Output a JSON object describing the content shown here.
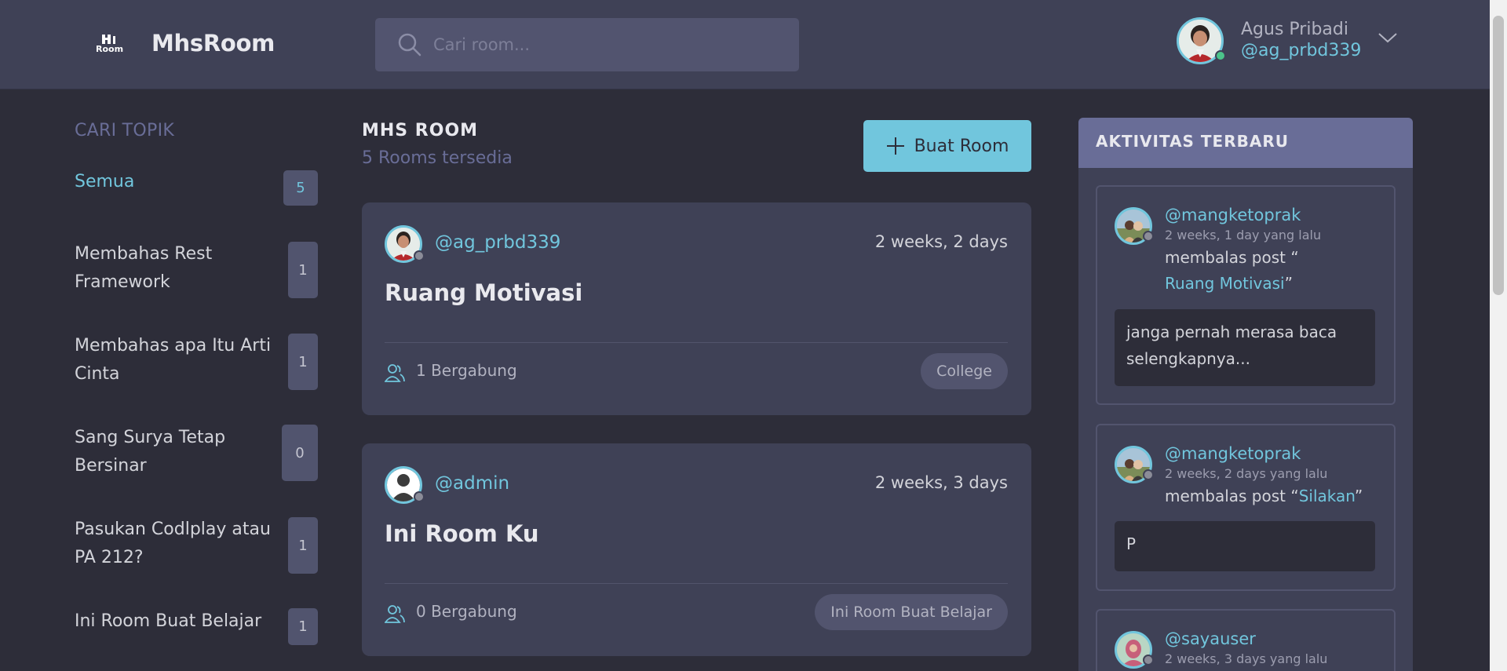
{
  "header": {
    "brand": "MhsRoom",
    "logo_text": "Room",
    "search_placeholder": "Cari room...",
    "user_name": "Agus Pribadi",
    "user_handle": "@ag_prbd339"
  },
  "topics": {
    "title": "CARI TOPIK",
    "items": [
      {
        "label": "Semua",
        "count": "5"
      },
      {
        "label": "Membahas Rest Framework",
        "count": "1"
      },
      {
        "label": "Membahas apa Itu Arti Cinta",
        "count": "1"
      },
      {
        "label": "Sang Surya Tetap Bersinar",
        "count": "0"
      },
      {
        "label": "Pasukan Codlplay atau PA 212?",
        "count": "1"
      },
      {
        "label": "Ini Room Buat Belajar",
        "count": "1"
      }
    ]
  },
  "main": {
    "title": "MHS ROOM",
    "count_text": "5 Rooms tersedia",
    "create_label": "Buat Room",
    "rooms": [
      {
        "host": "@ag_prbd339",
        "time": "2 weeks, 2 days",
        "name": "Ruang Motivasi",
        "joined": "1 Bergabung",
        "topic": "College"
      },
      {
        "host": "@admin",
        "time": "2 weeks, 3 days",
        "name": "Ini Room Ku",
        "joined": "0 Bergabung",
        "topic": "Ini Room Buat Belajar"
      }
    ]
  },
  "activity": {
    "title": "AKTIVITAS TERBARU",
    "items": [
      {
        "user": "@mangketoprak",
        "time": "2 weeks, 1 day yang lalu",
        "action": "membalas post “",
        "room": "Ruang Motivasi",
        "close": "”",
        "reply": "janga pernah merasa baca selengkapnya..."
      },
      {
        "user": "@mangketoprak",
        "time": "2 weeks, 2 days yang lalu",
        "action": "membalas post “",
        "room": "Silakan",
        "close": "”",
        "reply": "P"
      },
      {
        "user": "@sayauser",
        "time": "2 weeks, 3 days yang lalu"
      }
    ]
  },
  "colors": {
    "background": "#2d2d39",
    "header": "#3f4156",
    "card": "#3f4156",
    "accent": "#71c6dd",
    "muted": "#696d97"
  },
  "icons": [
    "room-logo-icon",
    "search-icon",
    "chevron-down-icon",
    "plus-icon",
    "users-icon",
    "default-user-icon"
  ]
}
